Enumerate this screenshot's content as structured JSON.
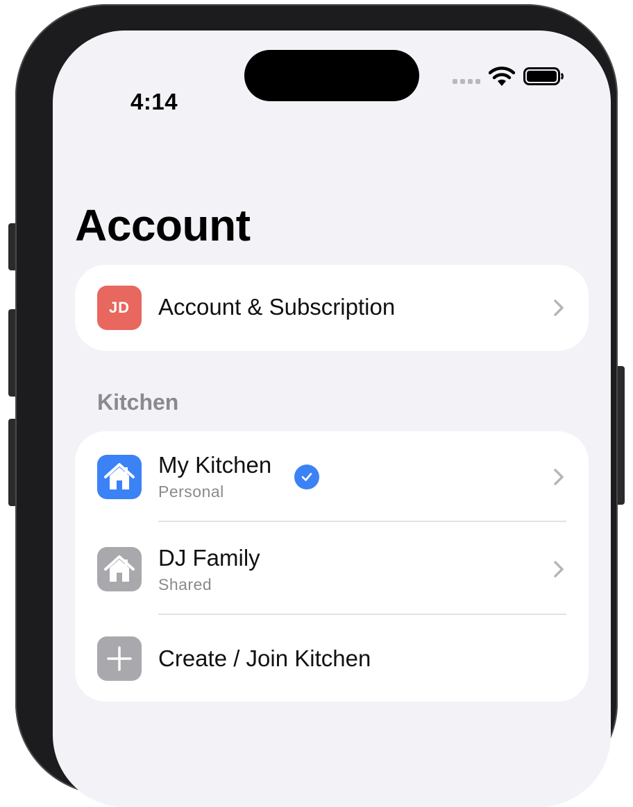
{
  "status_bar": {
    "time": "4:14"
  },
  "page": {
    "title": "Account"
  },
  "account_row": {
    "initials": "JD",
    "label": "Account & Subscription"
  },
  "kitchen_section": {
    "header": "Kitchen",
    "items": [
      {
        "title": "My Kitchen",
        "subtitle": "Personal",
        "selected": true
      },
      {
        "title": "DJ Family",
        "subtitle": "Shared",
        "selected": false
      },
      {
        "title": "Create / Join Kitchen"
      }
    ]
  },
  "colors": {
    "accent": "#3b82f6",
    "avatar": "#e8675f",
    "gray_icon": "#a8a8ad",
    "background": "#f2f2f7"
  },
  "icons": [
    "wifi-icon",
    "battery-icon",
    "signal-icon",
    "house-icon",
    "checkmark-icon",
    "plus-icon",
    "chevron-right-icon"
  ]
}
